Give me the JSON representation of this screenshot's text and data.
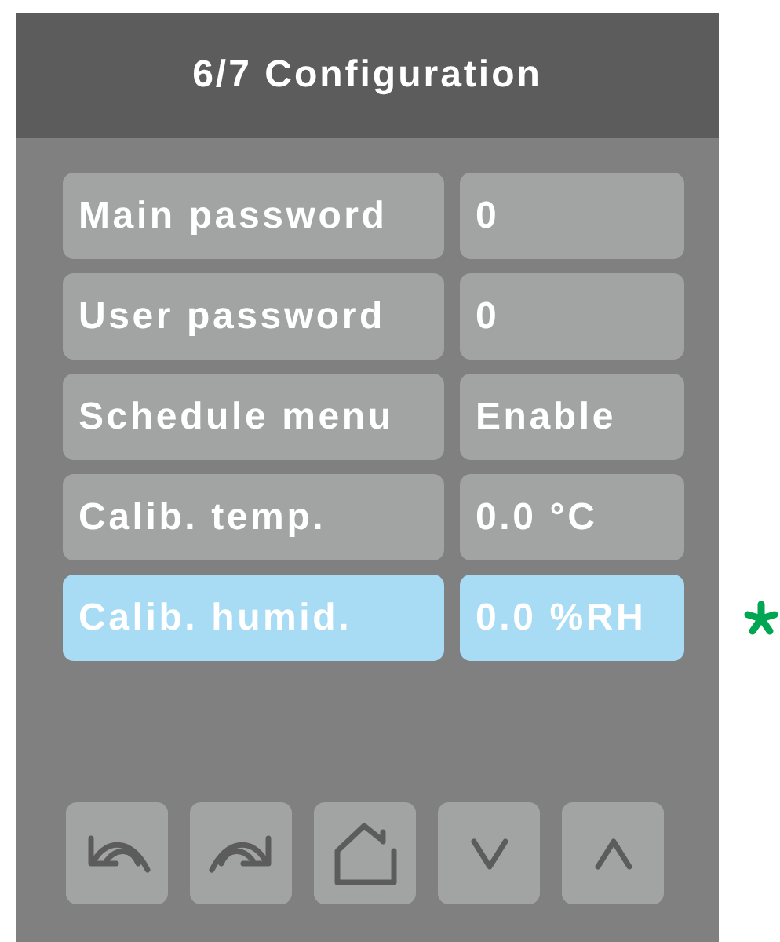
{
  "header": {
    "title": "6/7 Configuration"
  },
  "settings": [
    {
      "label": "Main password",
      "value": "0",
      "selected": false
    },
    {
      "label": "User password",
      "value": "0",
      "selected": false
    },
    {
      "label": "Schedule menu",
      "value": "Enable",
      "selected": false
    },
    {
      "label": "Calib. temp.",
      "value": "0.0 °C",
      "selected": false
    },
    {
      "label": "Calib. humid.",
      "value": "0.0 %RH",
      "selected": true
    }
  ],
  "buttons": [
    {
      "kind": "back"
    },
    {
      "kind": "forward"
    },
    {
      "kind": "home"
    },
    {
      "kind": "down"
    },
    {
      "kind": "up"
    }
  ]
}
